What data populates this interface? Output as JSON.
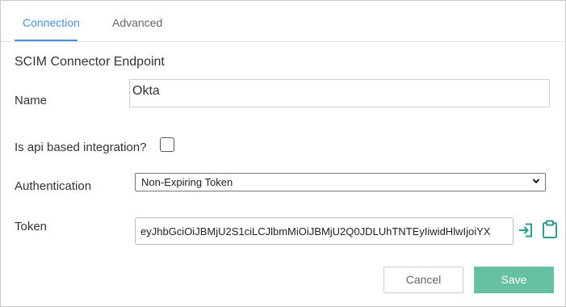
{
  "tabs": [
    {
      "label": "Connection",
      "active": true
    },
    {
      "label": "Advanced",
      "active": false
    }
  ],
  "form": {
    "section_title": "SCIM Connector Endpoint",
    "name_label": "Name",
    "name_value": "Okta",
    "api_label": "Is api based integration?",
    "api_checked": false,
    "auth_label": "Authentication",
    "auth_selected": "Non-Expiring Token",
    "token_label": "Token",
    "token_value": "eyJhbGciOiJBMjU2S1ciLCJlbmMiOiJBMjU2Q0JDLUhTNTEyIiwidHlwIjoiYX"
  },
  "buttons": {
    "cancel": "Cancel",
    "save": "Save"
  },
  "colors": {
    "accent": "#4a90d9",
    "save_button": "#66c0a3",
    "icon_teal": "#2a9d8f"
  },
  "icons": {
    "token_insert": "insert-icon",
    "clipboard": "clipboard-icon",
    "dropdown": "chevron-down-icon"
  }
}
